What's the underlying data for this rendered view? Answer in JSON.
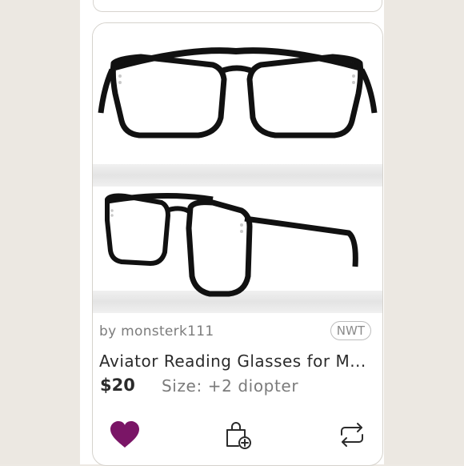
{
  "listing": {
    "seller": "by monsterk111",
    "condition_badge": "NWT",
    "title": "Aviator Reading Glasses for M...",
    "price": "$20",
    "size": "Size: +2 diopter"
  },
  "actions": {
    "like_icon": "heart-icon",
    "bundle_icon": "shopping-bag-plus-icon",
    "share_icon": "repost-arrows-icon"
  },
  "colors": {
    "heart": "#7a1566",
    "text_primary": "#2b2b2b",
    "text_secondary": "#7c7c7c",
    "frame": "#111111"
  }
}
